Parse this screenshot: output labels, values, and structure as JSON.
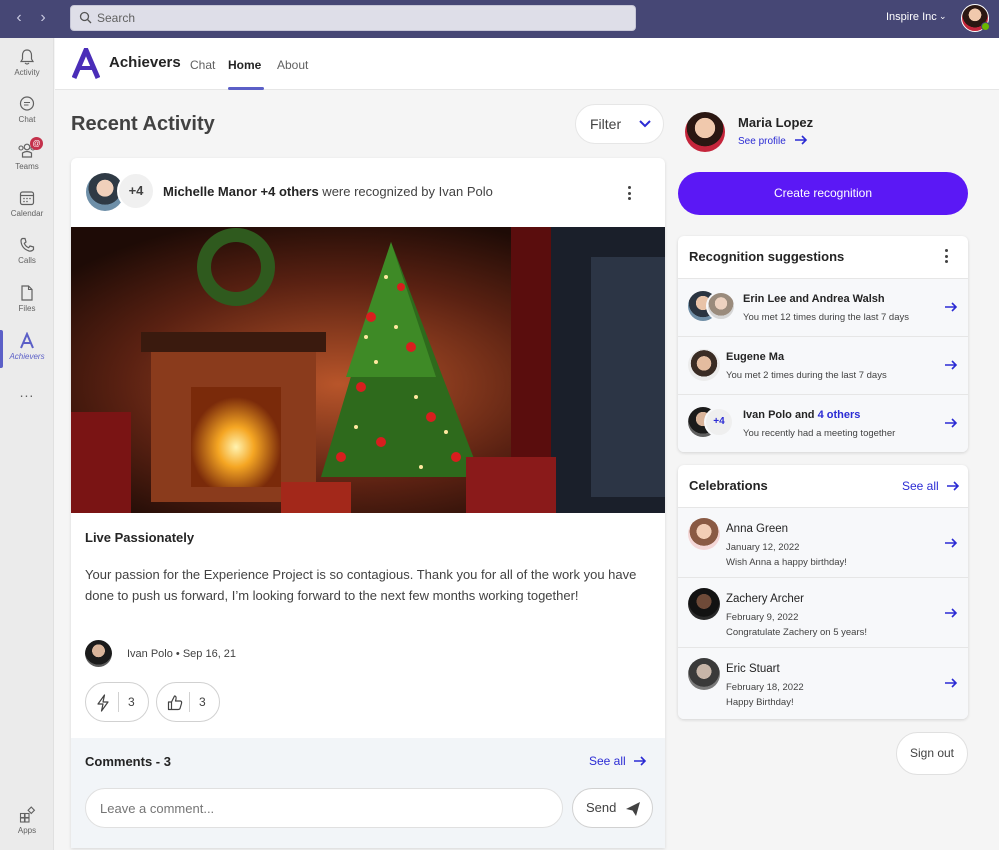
{
  "titlebar": {
    "search_placeholder": "Search",
    "org_name": "Inspire Inc",
    "theme_color": "#464775"
  },
  "rail": {
    "items": [
      {
        "label": "Activity",
        "icon": "bell-icon"
      },
      {
        "label": "Chat",
        "icon": "chat-icon"
      },
      {
        "label": "Teams",
        "icon": "teams-icon",
        "badge": "@"
      },
      {
        "label": "Calendar",
        "icon": "calendar-icon"
      },
      {
        "label": "Calls",
        "icon": "phone-icon"
      },
      {
        "label": "Files",
        "icon": "file-icon"
      },
      {
        "label": "Achievers",
        "icon": "achievers-icon",
        "active": true
      },
      {
        "label": "...",
        "icon": "more-icon"
      }
    ],
    "apps_label": "Apps"
  },
  "app": {
    "name": "Achievers",
    "tabs": [
      {
        "label": "Chat",
        "active": false
      },
      {
        "label": "Home",
        "active": true
      },
      {
        "label": "About",
        "active": false
      }
    ],
    "accent_color": "#5b5fc7"
  },
  "main": {
    "title": "Recent Activity",
    "filter_label": "Filter",
    "post": {
      "avatar_count": "+4",
      "headline_bold": "Michelle Manor +4 others",
      "headline_rest": " were recognized by Ivan Polo",
      "title": "Live Passionately",
      "body": "Your passion for the Experience Project is so contagious. Thank you for all of the work you have done to push us forward, I’m looking forward to the next few months working together!",
      "author_line": "Ivan Polo • Sep 16, 21",
      "reactions": [
        {
          "icon": "lightning-icon",
          "count": "3"
        },
        {
          "icon": "thumbs-up-icon",
          "count": "3"
        }
      ],
      "comments_title": "Comments - 3",
      "comments_see_all": "See all",
      "comment_placeholder": "Leave a comment...",
      "send_label": "Send"
    }
  },
  "profile": {
    "name": "Maria Lopez",
    "see_profile": "See profile",
    "create_label": "Create recognition",
    "create_color": "#5b18f5"
  },
  "suggestions": {
    "title": "Recognition suggestions",
    "items": [
      {
        "name": "Erin Lee and Andrea Walsh",
        "sub": "You met 12 times during the last 7 days"
      },
      {
        "name": "Eugene Ma",
        "sub": "You met 2 times during the last 7 days"
      },
      {
        "name_prefix": "Ivan Polo and ",
        "name_link": "4 others",
        "badge": "+4",
        "sub": "You recently had a meeting together"
      }
    ]
  },
  "celebrations": {
    "title": "Celebrations",
    "see_all": "See all",
    "items": [
      {
        "name": "Anna Green",
        "date": "January 12, 2022",
        "msg": "Wish Anna a happy birthday!"
      },
      {
        "name": "Zachery Archer",
        "date": "February 9, 2022",
        "msg": "Congratulate Zachery on 5 years!"
      },
      {
        "name": "Eric Stuart",
        "date": "February 18, 2022",
        "msg": "Happy Birthday!"
      }
    ]
  },
  "signout_label": "Sign out"
}
